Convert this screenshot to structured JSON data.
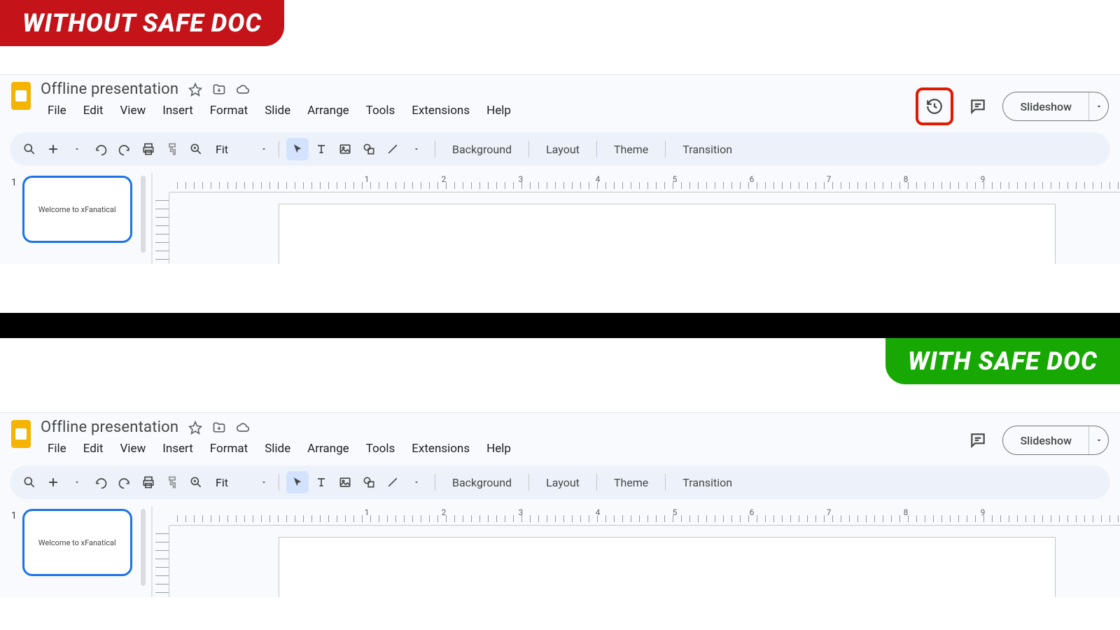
{
  "badges": {
    "without": "WITHOUT SAFE DOC",
    "with": "WITH SAFE DOC"
  },
  "doc": {
    "title": "Offline presentation"
  },
  "menu": {
    "file": "File",
    "edit": "Edit",
    "view": "View",
    "insert": "Insert",
    "format": "Format",
    "slide": "Slide",
    "arrange": "Arrange",
    "tools": "Tools",
    "extensions": "Extensions",
    "help": "Help"
  },
  "header_buttons": {
    "slideshow": "Slideshow"
  },
  "toolbar": {
    "zoom_label": "Fit",
    "background": "Background",
    "layout": "Layout",
    "theme": "Theme",
    "transition": "Transition"
  },
  "ruler_ticks": [
    "1",
    "2",
    "3",
    "4",
    "5",
    "6",
    "7",
    "8",
    "9"
  ],
  "slides": {
    "first_number": "1",
    "first_title": "Welcome to xFanatical"
  }
}
